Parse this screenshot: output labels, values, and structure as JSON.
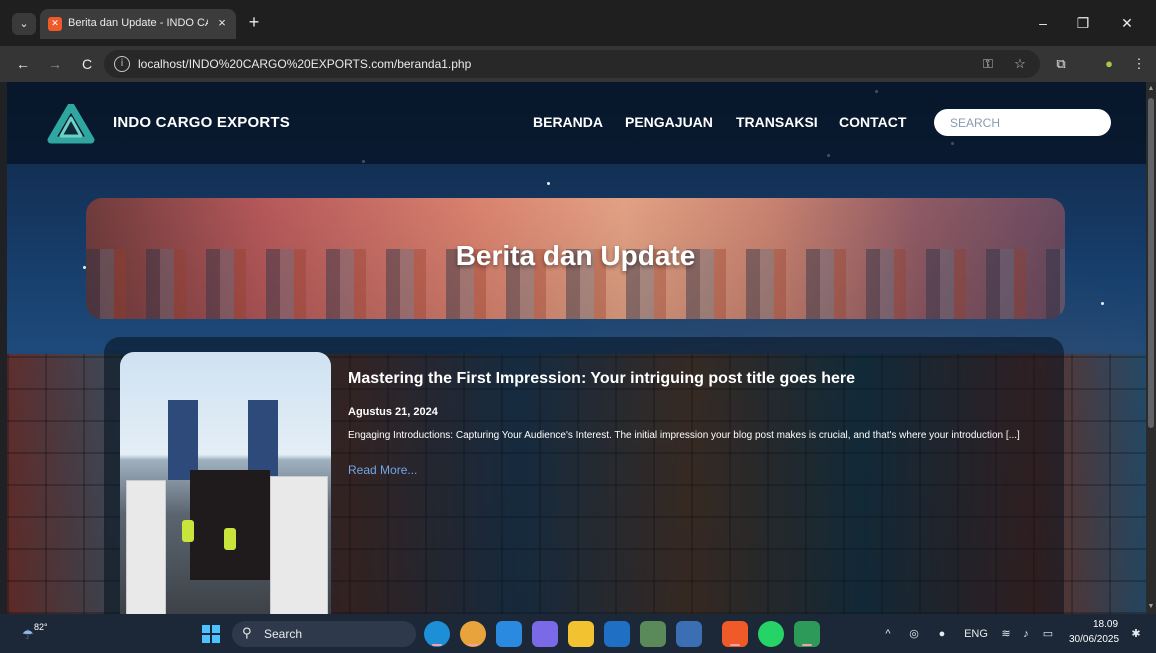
{
  "browser": {
    "tab_list_icon": "chevron-down-icon",
    "tab_title": "Berita dan Update - INDO CARGO EXPORTS",
    "tab_close": "×",
    "new_tab": "+",
    "window_controls": {
      "minimize": "–",
      "restore": "❐",
      "close": "✕"
    },
    "back": "←",
    "forward": "→",
    "reload": "C",
    "url": "localhost/INDO%20CARGO%20EXPORTS.com/beranda1.php",
    "site_info": "i"
  },
  "site": {
    "brand": "INDO CARGO EXPORTS",
    "nav": [
      "BERANDA",
      "PENGAJUAN",
      "TRANSAKSI",
      "CONTACT"
    ],
    "search_placeholder": "SEARCH",
    "accent": "#2fa7a0"
  },
  "hero": {
    "title": "Berita dan Update"
  },
  "post": {
    "title": "Mastering the First Impression: Your intriguing post title goes here",
    "date": "Agustus 21, 2024",
    "excerpt": "Engaging Introductions: Capturing Your Audience's Interest. The initial impression your blog post makes is crucial, and that's where your introduction [...]",
    "read_more": "Read More..."
  },
  "taskbar": {
    "weather_temp": "82°",
    "search_label": "Search",
    "apps": [
      "edge-icon",
      "chrome-icon",
      "vscode-icon",
      "copilot-icon",
      "file-explorer-icon",
      "outlook-icon",
      "photos-icon",
      "calculator-icon",
      "xampp-icon",
      "whatsapp-icon",
      "app-icon"
    ],
    "lang": "ENG",
    "time": "18.09",
    "date": "30/06/2025"
  }
}
